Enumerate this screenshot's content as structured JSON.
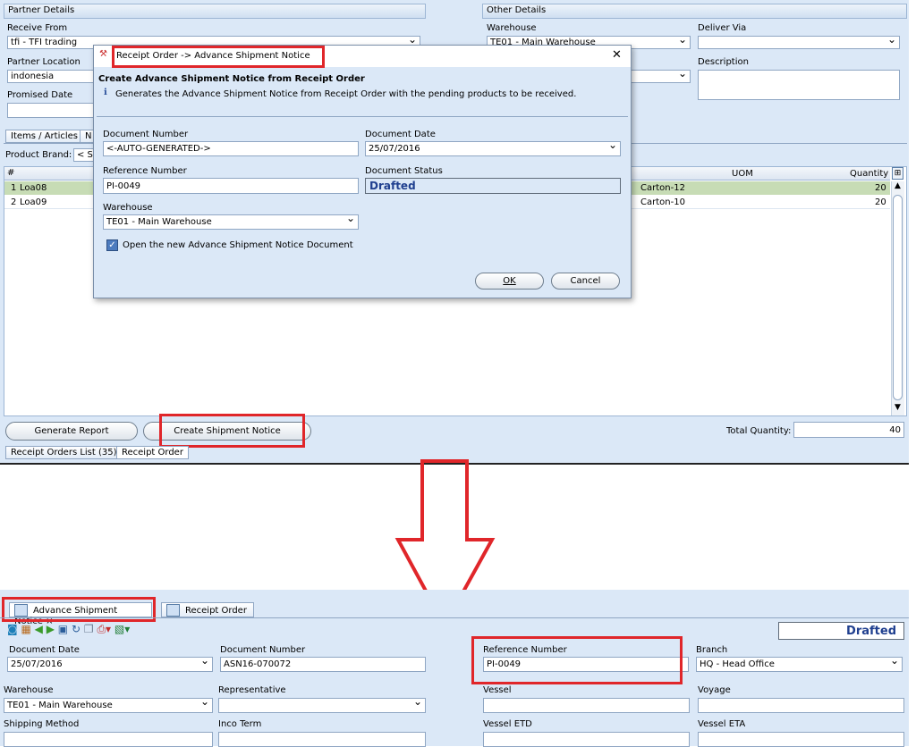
{
  "top": {
    "partner_details": {
      "header": "Partner Details",
      "receive_from_label": "Receive From",
      "receive_from_value": "tfi - TFI trading",
      "partner_location_label": "Partner Location",
      "partner_location_value": "indonesia",
      "promised_date_label": "Promised Date"
    },
    "other_details": {
      "header": "Other Details",
      "warehouse_label": "Warehouse",
      "warehouse_value": "TE01 - Main Warehouse",
      "deliver_via_label": "Deliver Via",
      "description_label": "Description"
    },
    "tabs": {
      "items": "Items / Articles",
      "other": "N"
    },
    "product_brand_label": "Product Brand:",
    "product_brand_value": "< Se",
    "grid": {
      "hash_header": "#",
      "uom_header": "UOM",
      "qty_header": "Quantity",
      "rows": [
        {
          "num": "1",
          "code": "Loa08",
          "uom": "Carton-12",
          "qty": "20"
        },
        {
          "num": "2",
          "code": "Loa09",
          "uom": "Carton-10",
          "qty": "20"
        }
      ]
    },
    "generate_report_btn": "Generate Report",
    "create_shipment_btn": "Create Shipment Notice",
    "total_quantity_label": "Total Quantity:",
    "total_quantity_value": "40",
    "bottom_tabs": {
      "list": "Receipt Orders List (35)",
      "order": "Receipt Order"
    }
  },
  "dialog": {
    "title": "Receipt Order -> Advance Shipment Notice",
    "heading": "Create Advance Shipment Notice from Receipt Order",
    "info": "Generates the Advance Shipment Notice from Receipt Order with the pending products to be received.",
    "doc_number_label": "Document Number",
    "doc_number_value": "<-AUTO-GENERATED->",
    "doc_date_label": "Document Date",
    "doc_date_value": "25/07/2016",
    "ref_number_label": "Reference Number",
    "ref_number_value": "PI-0049",
    "doc_status_label": "Document Status",
    "doc_status_value": "Drafted",
    "warehouse_label": "Warehouse",
    "warehouse_value": "TE01 - Main Warehouse",
    "open_checkbox_label": "Open the new Advance Shipment Notice Document",
    "ok_btn": "OK",
    "cancel_btn": "Cancel"
  },
  "bottom": {
    "tabs": {
      "asn": "Advance Shipment Notice",
      "ro": "Receipt Order"
    },
    "status": "Drafted",
    "doc_date_label": "Document Date",
    "doc_date_value": "25/07/2016",
    "doc_number_label": "Document Number",
    "doc_number_value": "ASN16-070072",
    "ref_number_label": "Reference Number",
    "ref_number_value": "PI-0049",
    "branch_label": "Branch",
    "branch_value": "HQ - Head Office",
    "warehouse_label": "Warehouse",
    "warehouse_value": "TE01 - Main Warehouse",
    "representative_label": "Representative",
    "vessel_label": "Vessel",
    "voyage_label": "Voyage",
    "shipping_method_label": "Shipping Method",
    "inco_term_label": "Inco Term",
    "vessel_etd_label": "Vessel ETD",
    "vessel_eta_label": "Vessel ETA"
  },
  "colors": {
    "highlight": "#e0262a",
    "panel": "#dbe8f7",
    "status_text": "#1f3f8f"
  }
}
